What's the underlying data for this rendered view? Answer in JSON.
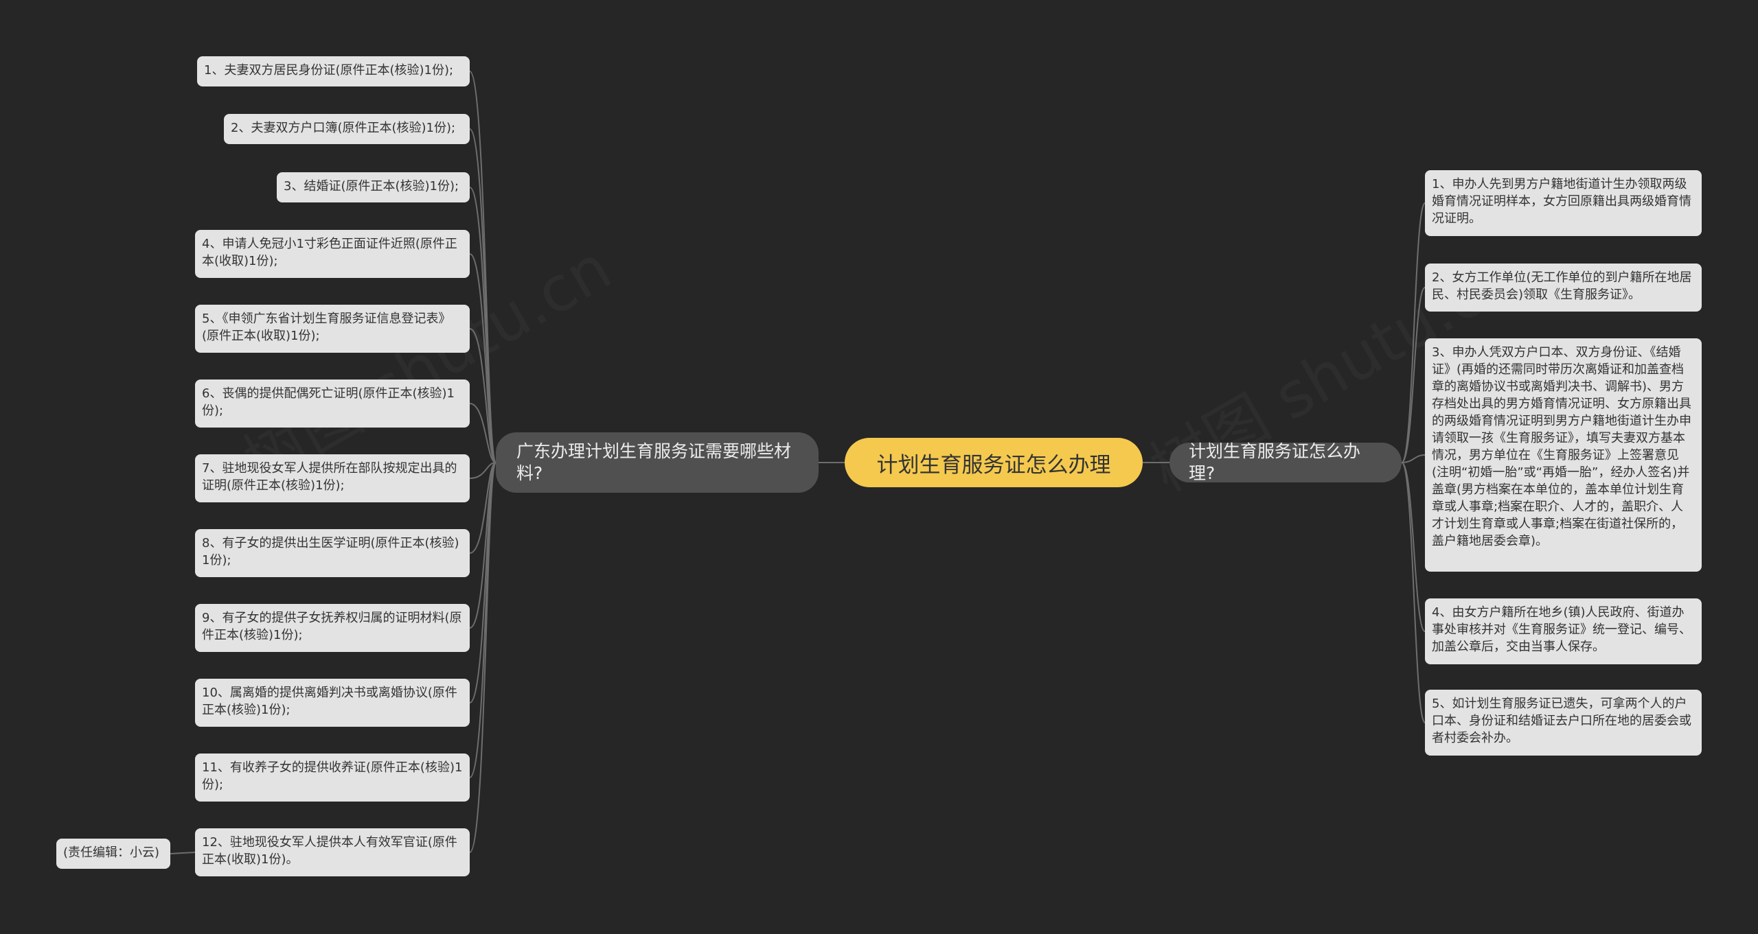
{
  "colors": {
    "background": "#262626",
    "root": "#f4c94e",
    "branch": "#505050",
    "leaf": "#e3e3e3",
    "line": "#6e6e6e"
  },
  "watermark": "树图 shutu.cn",
  "root": {
    "label": "计划生育服务证怎么办理"
  },
  "left_branch": {
    "label": "广东办理计划生育服务证需要哪些材料?",
    "items": [
      "1、夫妻双方居民身份证(原件正本(核验)1份);",
      "2、夫妻双方户口簿(原件正本(核验)1份);",
      "3、结婚证(原件正本(核验)1份);",
      "4、申请人免冠小1寸彩色正面证件近照(原件正本(收取)1份);",
      "5、《申领广东省计划生育服务证信息登记表》(原件正本(收取)1份);",
      "6、丧偶的提供配偶死亡证明(原件正本(核验)1份);",
      "7、驻地现役女军人提供所在部队按规定出具的证明(原件正本(核验)1份);",
      "8、有子女的提供出生医学证明(原件正本(核验)1份);",
      "9、有子女的提供子女抚养权归属的证明材料(原件正本(核验)1份);",
      "10、属离婚的提供离婚判决书或离婚协议(原件正本(核验)1份);",
      "11、有收养子女的提供收养证(原件正本(核验)1份);",
      "12、驻地现役女军人提供本人有效军官证(原件正本(收取)1份)。"
    ],
    "editor": "(责任编辑：小云)"
  },
  "right_branch": {
    "label": "计划生育服务证怎么办理?",
    "items": [
      "1、申办人先到男方户籍地街道计生办领取两级婚育情况证明样本，女方回原籍出具两级婚育情况证明。",
      "2、女方工作单位(无工作单位的到户籍所在地居民、村民委员会)领取《生育服务证》。",
      "3、申办人凭双方户口本、双方身份证、《结婚证》(再婚的还需同时带历次离婚证和加盖查档章的离婚协议书或离婚判决书、调解书)、男方存档处出具的男方婚育情况证明、女方原籍出具的两级婚育情况证明到男方户籍地街道计生办申请领取一孩《生育服务证》，填写夫妻双方基本情况，男方单位在《生育服务证》上签署意见(注明“初婚一胎”或“再婚一胎”，经办人签名)并盖章(男方档案在本单位的，盖本单位计划生育章或人事章;档案在职介、人才的，盖职介、人才计划生育章或人事章;档案在街道社保所的，盖户籍地居委会章)。",
      "4、由女方户籍所在地乡(镇)人民政府、街道办事处审核并对《生育服务证》统一登记、编号、加盖公章后，交由当事人保存。",
      "5、如计划生育服务证已遗失，可拿两个人的户口本、身份证和结婚证去户口所在地的居委会或者村委会补办。"
    ]
  }
}
